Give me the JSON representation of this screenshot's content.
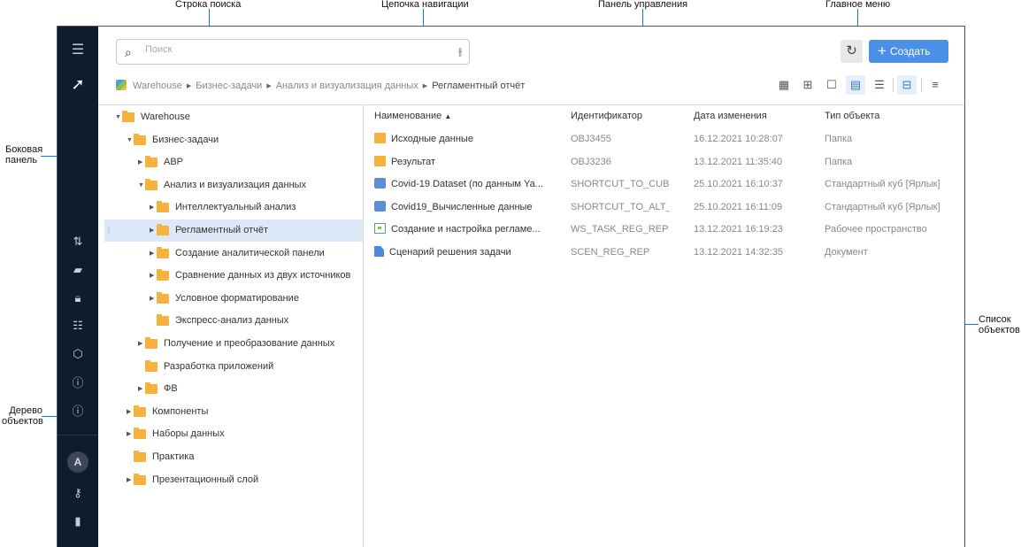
{
  "annotations": {
    "search": "Строка поиска",
    "breadcrumb": "Цепочка навигации",
    "toolbar": "Панель управления",
    "main_menu": "Главное меню",
    "sidebar": "Боковая панель",
    "tree": "Дерево объектов",
    "list": "Список объектов"
  },
  "colors": {
    "sidebar": "#0f1c2e",
    "accent": "#4a90e8",
    "callout": "#0a7fc8",
    "selection": "#dde9f8",
    "folder": "#f6b23c"
  },
  "sidebar": {
    "icons": [
      "menu-icon",
      "logo-icon",
      "import-export-icon",
      "briefcase-icon",
      "lock-icon",
      "toggle-icon",
      "cube-icon",
      "help-icon",
      "info-icon"
    ],
    "avatar_letter": "A",
    "bottom_icons": [
      "key-icon",
      "logout-icon"
    ]
  },
  "search": {
    "placeholder": "Поиск",
    "value": ""
  },
  "header": {
    "create_label": "Создать"
  },
  "breadcrumb": [
    "Warehouse",
    "Бизнес-задачи",
    "Анализ и визуализация данных",
    "Регламентный отчёт"
  ],
  "view_buttons": [
    {
      "icon": "small-grid-icon",
      "active": false
    },
    {
      "icon": "large-grid-icon",
      "active": false
    },
    {
      "icon": "tile-icon",
      "active": false
    },
    {
      "icon": "table-icon",
      "active": true
    },
    {
      "icon": "list-icon",
      "active": false
    },
    {
      "icon": "tree-toggle-icon",
      "active": true
    },
    {
      "icon": "filter-icon",
      "active": false
    }
  ],
  "tree": [
    {
      "label": "Warehouse",
      "level": 0,
      "state": "expanded"
    },
    {
      "label": "Бизнес-задачи",
      "level": 1,
      "state": "expanded"
    },
    {
      "label": "АВР",
      "level": 2,
      "state": "collapsed"
    },
    {
      "label": "Анализ и визуализация данных",
      "level": 2,
      "state": "expanded"
    },
    {
      "label": "Интеллектуальный анализ",
      "level": 3,
      "state": "collapsed"
    },
    {
      "label": "Регламентный отчёт",
      "level": 3,
      "state": "collapsed",
      "selected": true
    },
    {
      "label": "Создание аналитической панели",
      "level": 3,
      "state": "collapsed"
    },
    {
      "label": "Сравнение данных из двух источников",
      "level": 3,
      "state": "collapsed"
    },
    {
      "label": "Условное форматирование",
      "level": 3,
      "state": "collapsed"
    },
    {
      "label": "Экспресс-анализ данных",
      "level": 3,
      "state": "leaf"
    },
    {
      "label": "Получение и преобразование данных",
      "level": 2,
      "state": "collapsed"
    },
    {
      "label": "Разработка приложений",
      "level": 2,
      "state": "leaf"
    },
    {
      "label": "ФВ",
      "level": 2,
      "state": "collapsed"
    },
    {
      "label": "Компоненты",
      "level": 1,
      "state": "collapsed"
    },
    {
      "label": "Наборы данных",
      "level": 1,
      "state": "collapsed"
    },
    {
      "label": "Практика",
      "level": 1,
      "state": "leaf"
    },
    {
      "label": "Презентационный слой",
      "level": 1,
      "state": "collapsed"
    }
  ],
  "list": {
    "columns": [
      "Наименование",
      "Идентификатор",
      "Дата изменения",
      "Тип объекта"
    ],
    "sort": "ascending",
    "rows": [
      {
        "icon": "folder",
        "name": "Исходные данные",
        "id": "OBJ3455",
        "date": "16.12.2021 10:28:07",
        "type": "Папка"
      },
      {
        "icon": "folder",
        "name": "Результат",
        "id": "OBJ3236",
        "date": "13.12.2021 11:35:40",
        "type": "Папка"
      },
      {
        "icon": "cube",
        "name": "Covid-19 Dataset (по данным Ya...",
        "id": "SHORTCUT_TO_CUBE_",
        "date": "25.10.2021 16:10:37",
        "type": "Стандартный куб [Ярлык]"
      },
      {
        "icon": "cube",
        "name": "Covid19_Вычисленные данные",
        "id": "SHORTCUT_TO_ALT_C",
        "date": "25.10.2021 16:11:09",
        "type": "Стандартный куб [Ярлык]"
      },
      {
        "icon": "ws",
        "name": "Создание и настройка регламе...",
        "id": "WS_TASK_REG_REP",
        "date": "13.12.2021 16:19:23",
        "type": "Рабочее пространство"
      },
      {
        "icon": "doc",
        "name": "Сценарий решения задачи",
        "id": "SCEN_REG_REP",
        "date": "13.12.2021 14:32:35",
        "type": "Документ"
      }
    ]
  }
}
